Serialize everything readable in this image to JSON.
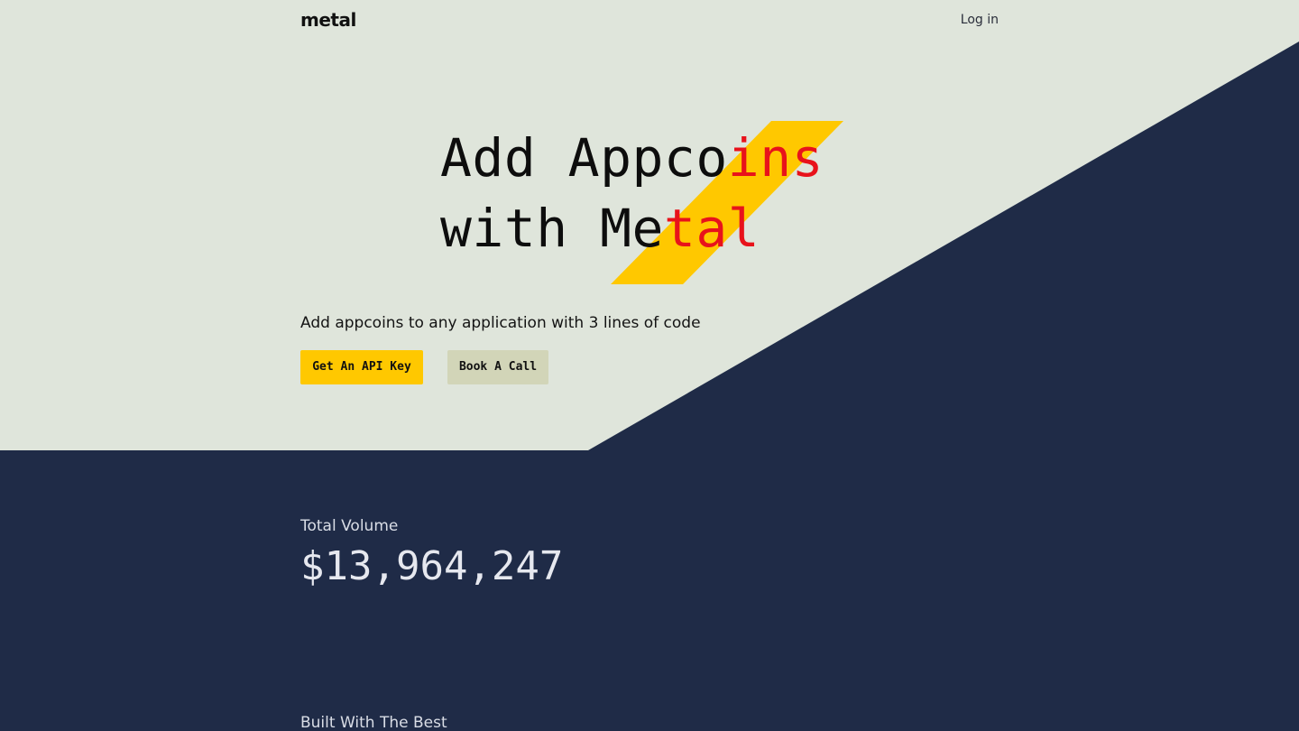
{
  "header": {
    "logo": "metal",
    "login_label": "Log in"
  },
  "hero": {
    "title_line1_plain": "Add Appco",
    "title_line1_accent": "ins",
    "title_line2_plain": "with Me",
    "title_line2_accent": "tal",
    "subtitle": "Add appcoins to any application with 3 lines of code",
    "primary_button": "Get An API Key",
    "secondary_button": "Book A Call"
  },
  "stats": {
    "label": "Total Volume",
    "value": "$13,964,247"
  },
  "sections": {
    "built_with_heading": "Built With The Best"
  },
  "colors": {
    "hero_background": "#dfe5db",
    "dark_background": "#1f2b47",
    "accent_yellow": "#ffc800",
    "accent_red": "#e8121b",
    "secondary_button": "#d2d5b8"
  }
}
